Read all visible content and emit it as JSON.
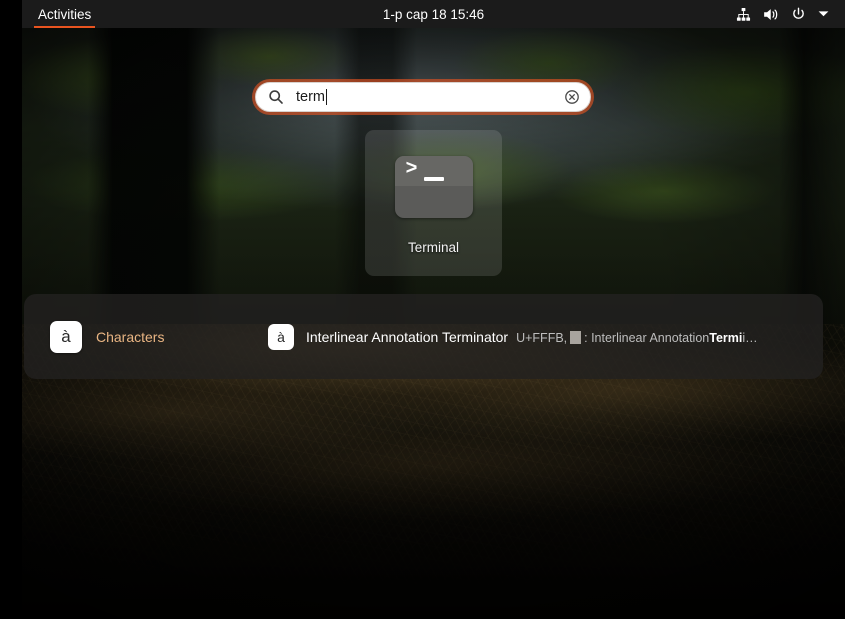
{
  "top_bar": {
    "activities_label": "Activities",
    "clock": "1-p cap 18  15:46",
    "accent_color": "#e95420",
    "status_icons": [
      {
        "name": "network-wired-icon"
      },
      {
        "name": "volume-icon"
      },
      {
        "name": "power-icon"
      },
      {
        "name": "chevron-down-icon"
      }
    ]
  },
  "search": {
    "value": "term",
    "placeholder": "Type to search",
    "icon": "search-icon",
    "clear_icon": "clear-icon"
  },
  "app_results": {
    "items": [
      {
        "label": "Terminal",
        "icon": "terminal-icon",
        "prompt_glyph": ">",
        "selected": true
      }
    ]
  },
  "provider_results": {
    "provider": {
      "title": "Characters",
      "icon_glyph": "à",
      "icon": "characters-icon"
    },
    "items": [
      {
        "icon_glyph": "à",
        "title": "Interlinear Annotation Terminator",
        "subtitle_prefix": "U+FFFB,",
        "subtitle_middle": ": Interlinear Annotation ",
        "subtitle_highlight": "Termi",
        "subtitle_suffix": "i…"
      }
    ]
  }
}
